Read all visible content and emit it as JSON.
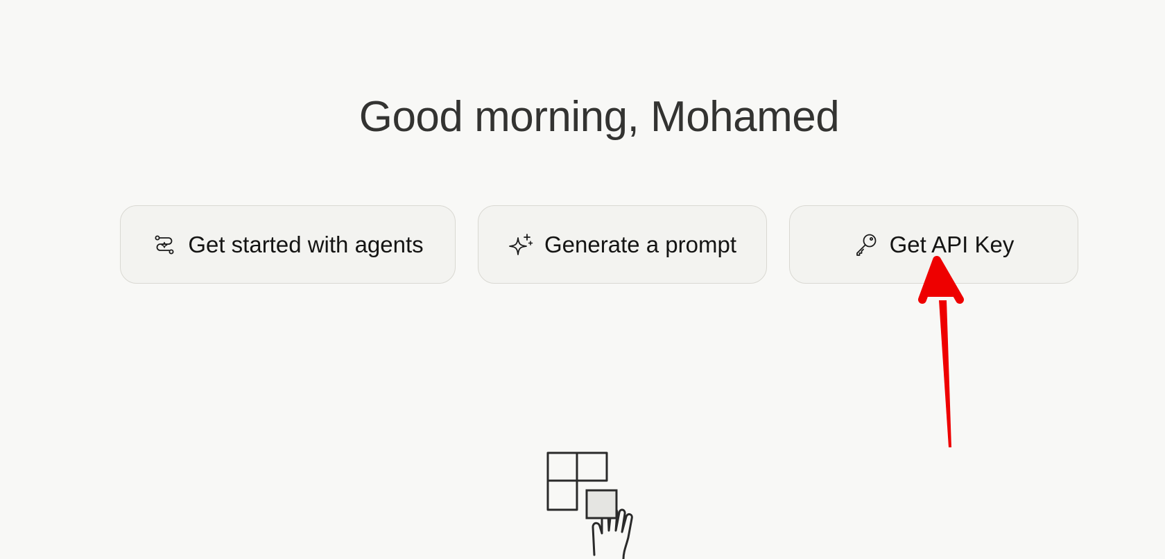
{
  "greeting": "Good morning, Mohamed",
  "actions": [
    {
      "label": "Get started with agents",
      "icon": "agents-flow-icon"
    },
    {
      "label": "Generate a prompt",
      "icon": "sparkle-icon"
    },
    {
      "label": "Get API Key",
      "icon": "key-icon"
    }
  ],
  "colors": {
    "background": "#f8f8f6",
    "button_background": "#f3f3f0",
    "button_border": "#d9d8d2",
    "annotation_arrow": "#ee0000"
  }
}
